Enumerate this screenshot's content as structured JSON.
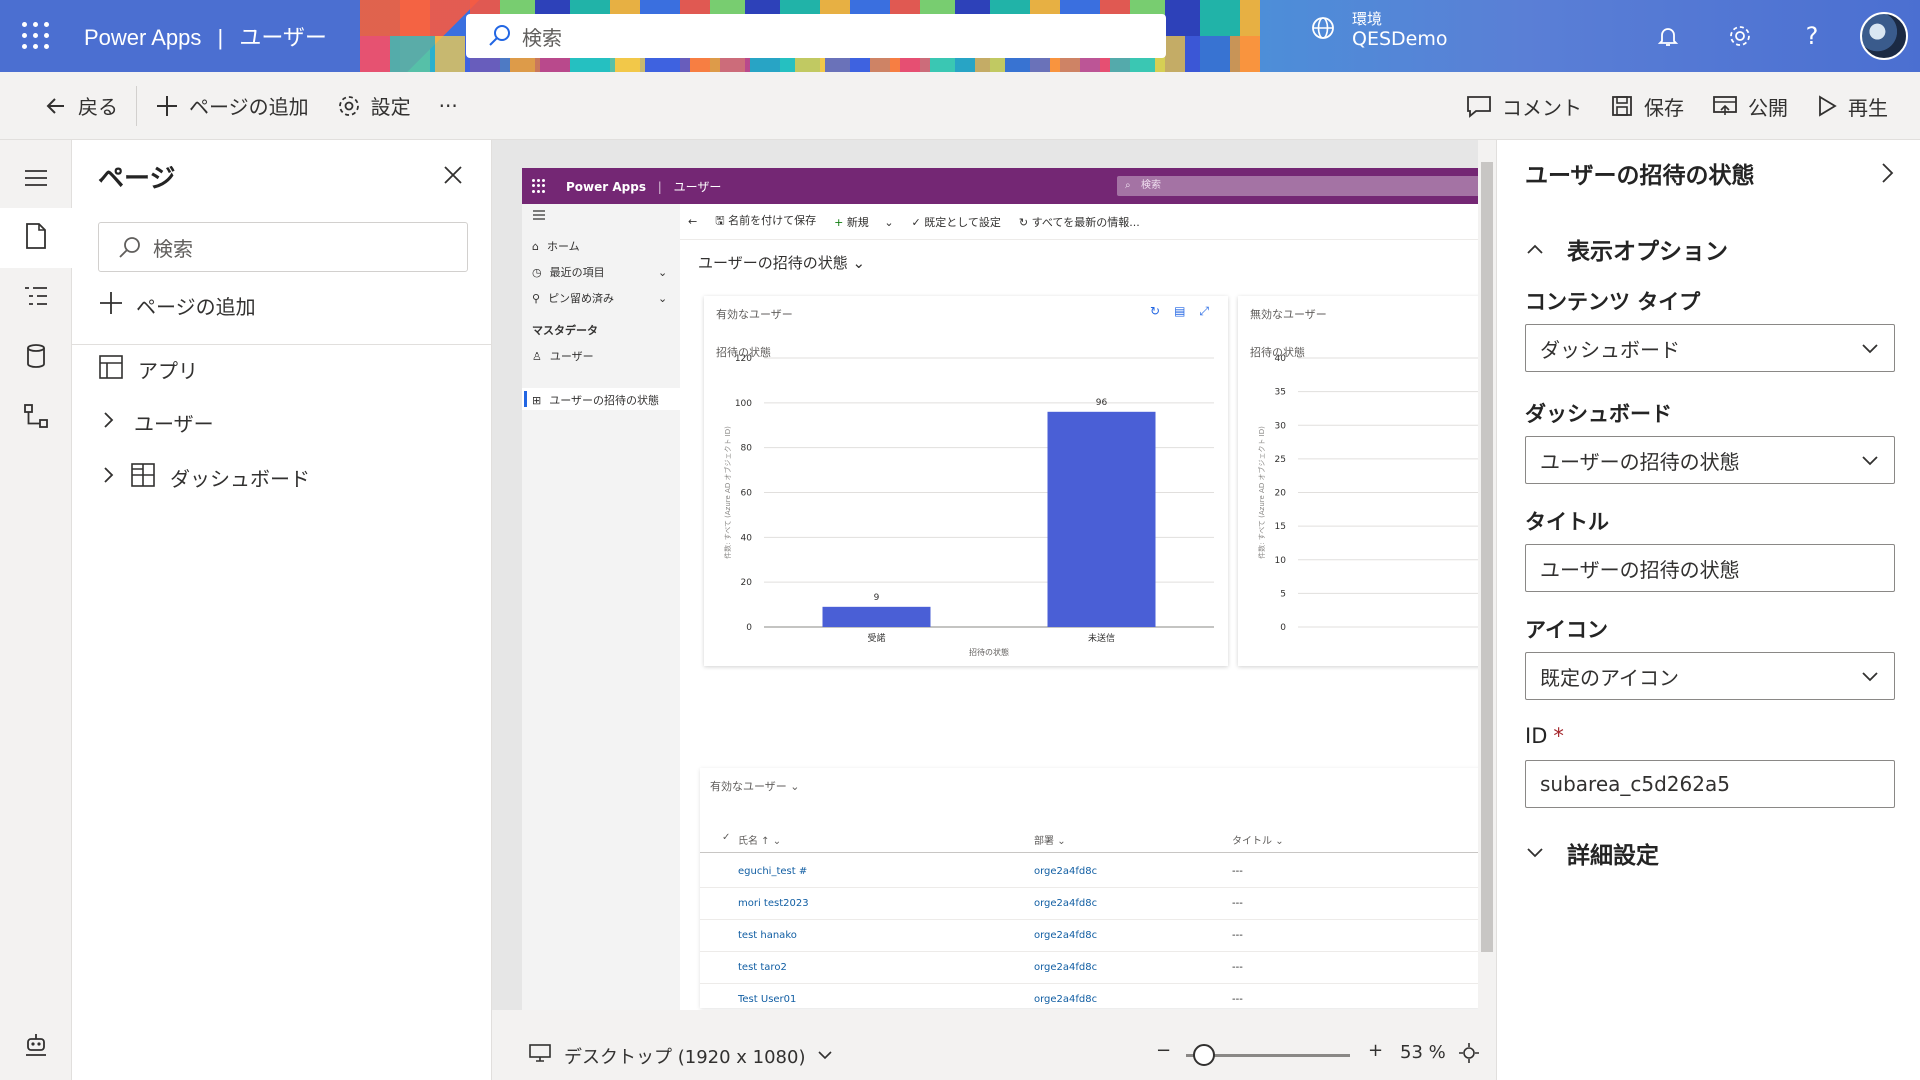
{
  "header": {
    "app_name": "Power Apps",
    "separator": "|",
    "app_section": "ユーザー",
    "search_placeholder": "検索",
    "env_label": "環境",
    "env_name": "QESDemo"
  },
  "colors": {
    "header_bg": "#4b6fd1",
    "accent": "#742774",
    "bar_fill": "#4a5fd6",
    "link": "#115ea3"
  },
  "commands": {
    "back": "戻る",
    "add_page": "ページの追加",
    "settings": "設定",
    "more": "···",
    "comment": "コメント",
    "save": "保存",
    "publish": "公開",
    "play": "再生"
  },
  "pages_panel": {
    "title": "ページ",
    "search_placeholder": "検索",
    "add_page": "ページの追加",
    "items": [
      {
        "label": "アプリ",
        "icon": "app-icon"
      },
      {
        "label": "ユーザー",
        "icon": "chevron-right-icon"
      },
      {
        "label": "ダッシュボード",
        "icon": "dashboard-icon"
      }
    ]
  },
  "preview": {
    "top_title": "Power Apps",
    "top_section": "ユーザー",
    "top_search": "検索",
    "nav": {
      "home": "ホーム",
      "recent": "最近の項目",
      "pinned": "ピン留め済み",
      "group": "マスタデータ",
      "users": "ユーザー",
      "invite_status": "ユーザーの招待の状態"
    },
    "cmd": {
      "save_as": "名前を付けて保存",
      "new": "新規",
      "set_default": "既定として設定",
      "refresh_all": "すべてを最新の情報..."
    },
    "dashboard_title": "ユーザーの招待の状態",
    "card2_title": "無効なユーザー",
    "card2_subtitle": "招待の状態",
    "card2_ticks": [
      "40",
      "35",
      "30",
      "25",
      "20",
      "15",
      "10",
      "5",
      "0"
    ],
    "card2_ylabel": "件数: すべて (Azure AD オブジェクト ID)",
    "grid": {
      "title": "有効なユーザー",
      "col_name": "氏名 ↑",
      "col_dept": "部署",
      "col_title": "タイトル",
      "rows": [
        {
          "name": "eguchi_test #",
          "dept": "orge2a4fd8c",
          "title": "---"
        },
        {
          "name": "mori test2023",
          "dept": "orge2a4fd8c",
          "title": "---"
        },
        {
          "name": "test hanako",
          "dept": "orge2a4fd8c",
          "title": "---"
        },
        {
          "name": "test taro2",
          "dept": "orge2a4fd8c",
          "title": "---"
        },
        {
          "name": "Test User01",
          "dept": "orge2a4fd8c",
          "title": "---"
        }
      ]
    }
  },
  "chart_data": {
    "type": "bar",
    "title": "有効なユーザー",
    "subtitle": "招待の状態",
    "categories": [
      "受諾",
      "未送信"
    ],
    "values": [
      9,
      96
    ],
    "xlabel": "招待の状態",
    "ylabel": "件数: すべて (Azure AD オブジェクト ID)",
    "ylim": [
      0,
      120
    ],
    "yticks": [
      0,
      20,
      40,
      60,
      80,
      100,
      120
    ],
    "grid": true
  },
  "status": {
    "device": "デスクトップ (1920 x 1080)",
    "zoom_minus": "−",
    "zoom_plus": "+",
    "zoom_value": "53 %",
    "zoom_fraction": 0.53
  },
  "props": {
    "title": "ユーザーの招待の状態",
    "display_options": "表示オプション",
    "content_type_label": "コンテンツ タイプ",
    "content_type_value": "ダッシュボード",
    "dashboard_label": "ダッシュボード",
    "dashboard_value": "ユーザーの招待の状態",
    "title_label": "タイトル",
    "title_value": "ユーザーの招待の状態",
    "icon_label": "アイコン",
    "icon_value": "既定のアイコン",
    "id_label": "ID",
    "id_required": "*",
    "id_value": "subarea_c5d262a5",
    "advanced": "詳細設定"
  }
}
